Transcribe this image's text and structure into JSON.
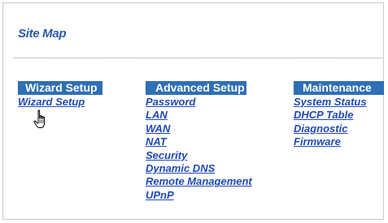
{
  "page": {
    "title": "Site Map"
  },
  "columns": {
    "wizard": {
      "heading": "Wizard Setup",
      "links": [
        "Wizard Setup"
      ]
    },
    "advanced": {
      "heading": "Advanced Setup",
      "links": [
        "Password",
        "LAN",
        "WAN",
        "NAT",
        "Security",
        "Dynamic DNS",
        "Remote Management",
        "UPnP"
      ]
    },
    "maintenance": {
      "heading": "Maintenance",
      "links": [
        "System Status",
        "DHCP Table",
        "Diagnostic",
        "Firmware"
      ]
    }
  },
  "cursor": {
    "icon": "hand-pointer-icon"
  },
  "colors": {
    "title": "#2b59a8",
    "header_bg": "#2f6fb5",
    "link": "#1f49b3"
  }
}
